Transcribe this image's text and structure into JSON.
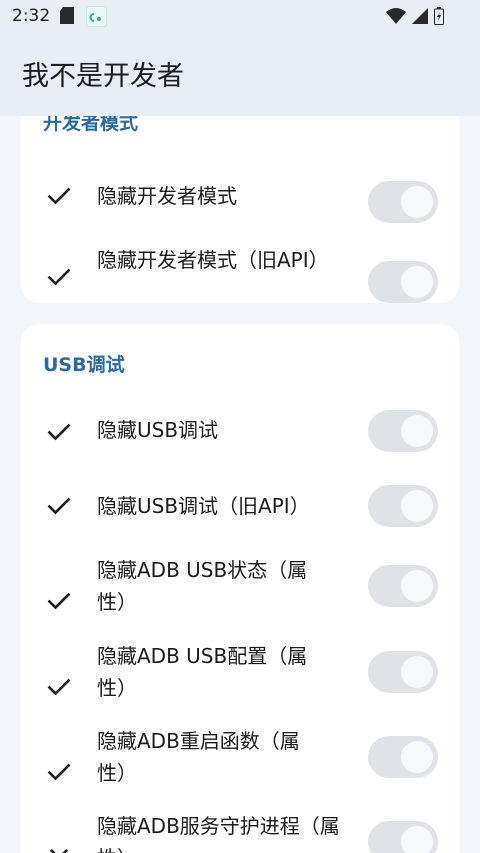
{
  "status_bar": {
    "time": "2:32"
  },
  "app_bar": {
    "title": "我不是开发者"
  },
  "sections": [
    {
      "title": "开发者模式",
      "items": [
        {
          "label": "隐藏开发者模式",
          "checked": true,
          "enabled": false
        },
        {
          "label": "隐藏开发者模式（旧API）",
          "checked": true,
          "enabled": false
        }
      ]
    },
    {
      "title": "USB调试",
      "items": [
        {
          "label": "隐藏USB调试",
          "checked": true,
          "enabled": false
        },
        {
          "label": "隐藏USB调试（旧API）",
          "checked": true,
          "enabled": false
        },
        {
          "label": "隐藏ADB USB状态（属性）",
          "checked": true,
          "enabled": false
        },
        {
          "label": "隐藏ADB USB配置（属性）",
          "checked": true,
          "enabled": false
        },
        {
          "label": "隐藏ADB重启函数（属性）",
          "checked": true,
          "enabled": false
        },
        {
          "label": "隐藏ADB服务守护进程（属性）",
          "checked": false,
          "enabled": false
        }
      ]
    }
  ],
  "colors": {
    "accent": "#2d6aa1",
    "background": "#f3f6fb",
    "card": "#ffffff",
    "switch_track": "#dfe2e7",
    "switch_thumb": "#f7f8fa"
  },
  "icons": {
    "checked": "check-icon",
    "unchecked": "close-icon"
  }
}
